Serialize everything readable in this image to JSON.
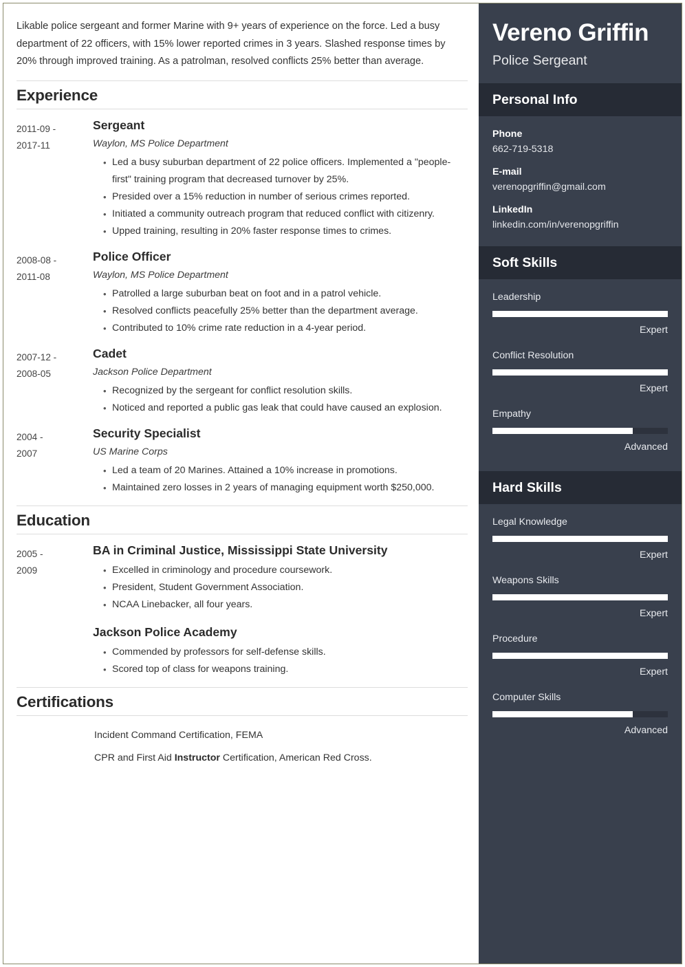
{
  "theme": {
    "page_border": "#8a8a6b",
    "sidebar_bg": "#39404d",
    "sidebar_band_bg": "#262b35",
    "bar_fill": "#ffffff",
    "bar_track": "#2d323d",
    "text": "#333333"
  },
  "main": {
    "summary": "Likable police sergeant and former Marine with 9+ years of experience on the force. Led a busy department of 22 officers, with 15% lower reported crimes in 3 years. Slashed response times by 20% through improved training. As a patrolman, resolved conflicts 25% better than average.",
    "sections": {
      "experience": {
        "heading": "Experience",
        "entries": [
          {
            "date_from": "2011-09 -",
            "date_to": "2017-11",
            "title": "Sergeant",
            "org": "Waylon, MS Police Department",
            "bullets": [
              "Led a busy suburban department of 22 police officers. Implemented a \"people-first\" training program that decreased turnover by 25%.",
              "Presided over a 15% reduction in number of serious crimes reported.",
              "Initiated a community outreach program that reduced conflict with citizenry.",
              "Upped training, resulting in 20% faster response times to crimes."
            ]
          },
          {
            "date_from": "2008-08 -",
            "date_to": "2011-08",
            "title": "Police Officer",
            "org": "Waylon, MS Police Department",
            "bullets": [
              "Patrolled a large suburban beat on foot and in a patrol vehicle.",
              "Resolved conflicts peacefully 25% better than the department average.",
              "Contributed to 10% crime rate reduction in a 4-year period."
            ]
          },
          {
            "date_from": "2007-12 -",
            "date_to": "2008-05",
            "title": "Cadet",
            "org": "Jackson Police Department",
            "bullets": [
              "Recognized by the sergeant for conflict resolution skills.",
              "Noticed and reported a public gas leak that could have caused an explosion."
            ]
          },
          {
            "date_from": "2004 -",
            "date_to": "2007",
            "title": "Security Specialist",
            "org": "US Marine Corps",
            "bullets": [
              "Led a team of 20 Marines. Attained a 10% increase in promotions.",
              "Maintained zero losses in 2 years of managing equipment worth $250,000."
            ]
          }
        ]
      },
      "education": {
        "heading": "Education",
        "entries": [
          {
            "date_from": "2005 -",
            "date_to": "2009",
            "title": "BA in Criminal Justice, Mississippi State University",
            "bullets": [
              "Excelled in criminology and procedure coursework.",
              "President, Student Government Association.",
              "NCAA Linebacker, all four years."
            ],
            "sub_title": "Jackson Police Academy",
            "sub_bullets": [
              "Commended by professors for self-defense skills.",
              "Scored top of class for weapons training."
            ]
          }
        ]
      },
      "certifications": {
        "heading": "Certifications",
        "items": [
          {
            "text_before": "Incident Command Certification, FEMA",
            "bold": "",
            "text_after": ""
          },
          {
            "text_before": "CPR and First Aid ",
            "bold": "Instructor",
            "text_after": " Certification, American Red Cross."
          }
        ]
      }
    }
  },
  "sidebar": {
    "name": "Vereno Griffin",
    "job_title": "Police Sergeant",
    "personal_info": {
      "heading": "Personal Info",
      "items": [
        {
          "label": "Phone",
          "value": "662-719-5318"
        },
        {
          "label": "E-mail",
          "value": "verenopgriffin@gmail.com"
        },
        {
          "label": "LinkedIn",
          "value": "linkedin.com/in/verenopgriffin"
        }
      ]
    },
    "soft_skills": {
      "heading": "Soft Skills",
      "items": [
        {
          "name": "Leadership",
          "level": "Expert",
          "percent": 100
        },
        {
          "name": "Conflict Resolution",
          "level": "Expert",
          "percent": 100
        },
        {
          "name": "Empathy",
          "level": "Advanced",
          "percent": 80
        }
      ]
    },
    "hard_skills": {
      "heading": "Hard Skills",
      "items": [
        {
          "name": "Legal Knowledge",
          "level": "Expert",
          "percent": 100
        },
        {
          "name": "Weapons Skills",
          "level": "Expert",
          "percent": 100
        },
        {
          "name": "Procedure",
          "level": "Expert",
          "percent": 100
        },
        {
          "name": "Computer Skills",
          "level": "Advanced",
          "percent": 80
        }
      ]
    }
  }
}
